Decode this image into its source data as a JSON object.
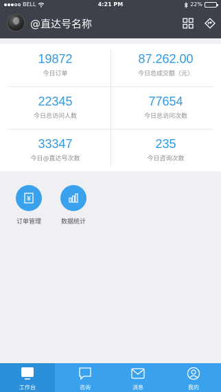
{
  "status_bar": {
    "carrier": "BELL",
    "time": "4:21 PM",
    "battery": "22%",
    "battery_level": 0.22
  },
  "header": {
    "title": "@直达号名称"
  },
  "stats": [
    {
      "value": "19872",
      "label": "今日订单"
    },
    {
      "value": "87.262.00",
      "label": "今日总成交额（元）"
    },
    {
      "value": "22345",
      "label": "今日总访问人数"
    },
    {
      "value": "77654",
      "label": "今日总访问次数"
    },
    {
      "value": "33347",
      "label": "今日@直达号次数"
    },
    {
      "value": "235",
      "label": "今日咨询次数"
    }
  ],
  "functions": [
    {
      "label": "订单管理",
      "icon": "order-icon"
    },
    {
      "label": "数据统计",
      "icon": "bar-chart-icon"
    }
  ],
  "tabs": [
    {
      "label": "工作台",
      "icon": "workbench-icon",
      "active": true
    },
    {
      "label": "咨询",
      "icon": "chat-bubble-icon",
      "active": false
    },
    {
      "label": "消息",
      "icon": "envelope-icon",
      "active": false
    },
    {
      "label": "我的",
      "icon": "user-icon",
      "active": false
    }
  ],
  "colors": {
    "header_bg": "#3d424a",
    "accent": "#3aa1ec",
    "number_text": "#2f9ae3",
    "tab_active_bg": "#2b8fd9"
  }
}
